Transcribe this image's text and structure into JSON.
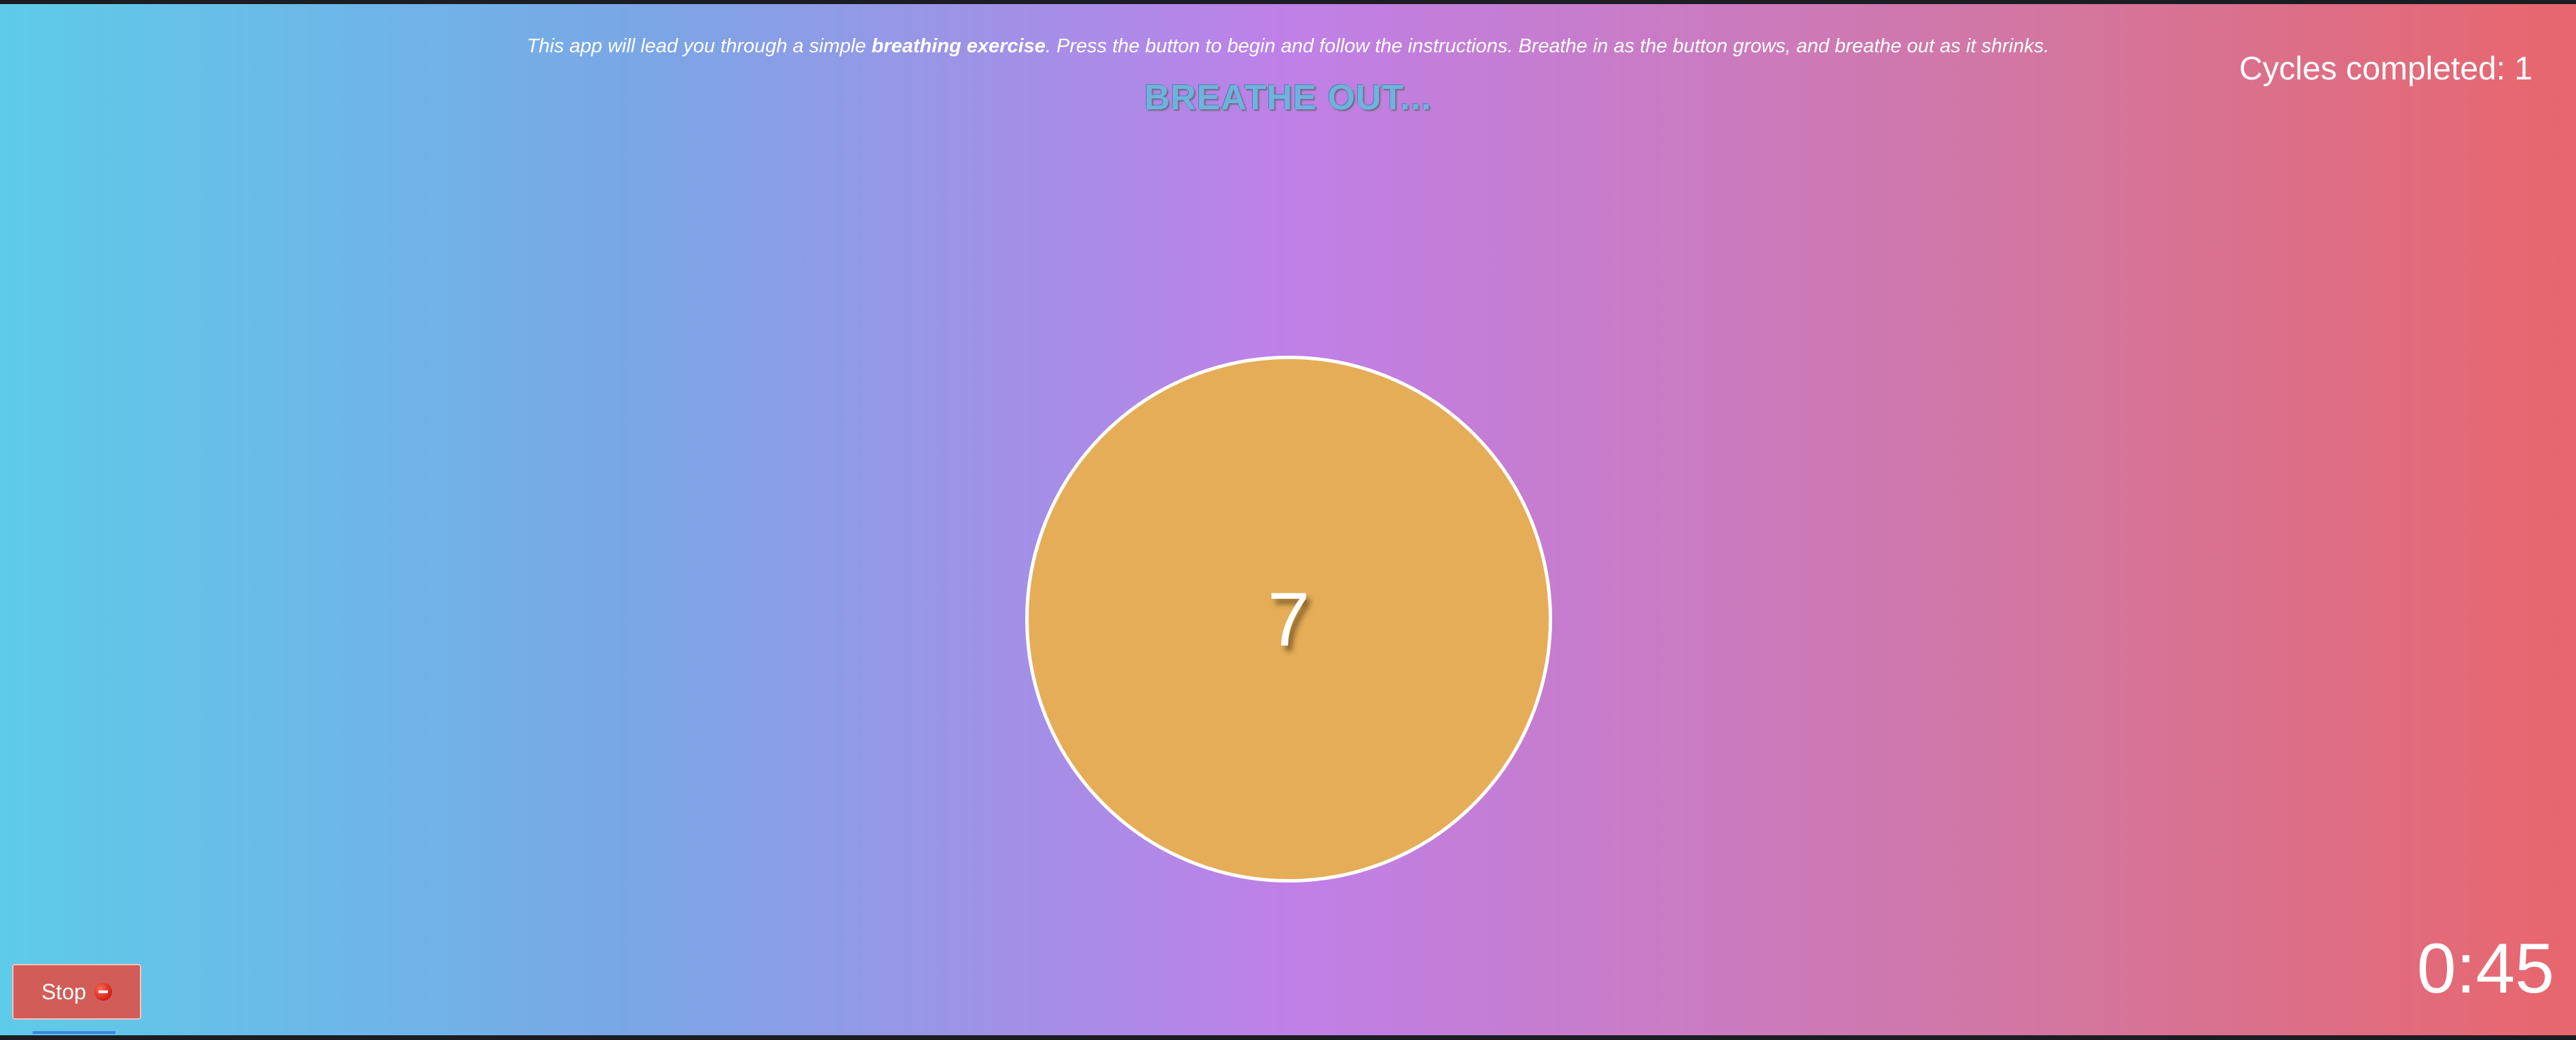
{
  "intro": {
    "before": "This app will lead you through a simple ",
    "bold": "breathing exercise",
    "after": ". Press the button to begin and follow the instructions. Breathe in as the button grows, and breathe out as it shrinks."
  },
  "instruction": "BREATHE OUT...",
  "cycles_label": "Cycles completed: 1",
  "breath_button": {
    "count": "7",
    "color": "#e5ad57"
  },
  "stop_button": {
    "label": "Stop",
    "icon": "no-entry-icon",
    "color": "#d25c57"
  },
  "timer": "0:45",
  "colors": {
    "gradient_left": "#5ecbe9",
    "gradient_mid": "#bf80e8",
    "gradient_right": "#e8666c"
  }
}
